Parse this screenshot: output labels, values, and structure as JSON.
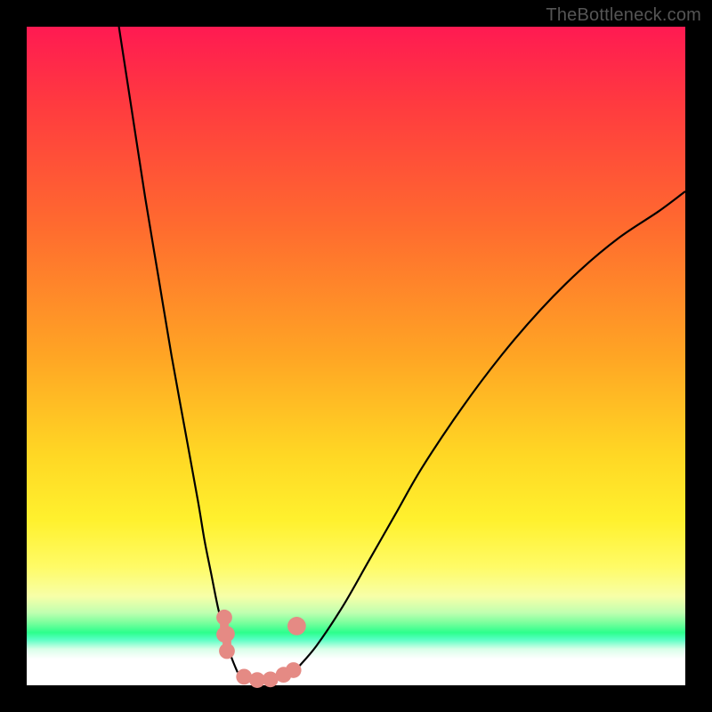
{
  "watermark": "TheBottleneck.com",
  "chart_data": {
    "type": "line",
    "title": "",
    "xlabel": "",
    "ylabel": "",
    "xlim": [
      0,
      100
    ],
    "ylim": [
      0,
      100
    ],
    "grid": false,
    "legend": false,
    "series": [
      {
        "name": "left_branch",
        "x": [
          14,
          16,
          18,
          20,
          22,
          24,
          26,
          27,
          28,
          29,
          30,
          31,
          32
        ],
        "y": [
          100,
          87,
          74,
          62,
          50,
          39,
          28,
          22,
          17,
          12,
          8,
          4.5,
          2
        ]
      },
      {
        "name": "valley_floor",
        "x": [
          32,
          33,
          34,
          35,
          36,
          37,
          38,
          39,
          40,
          41
        ],
        "y": [
          2,
          1.2,
          0.8,
          0.6,
          0.6,
          0.8,
          1.2,
          1.6,
          2,
          2.5
        ]
      },
      {
        "name": "right_branch",
        "x": [
          41,
          44,
          48,
          52,
          56,
          60,
          66,
          72,
          78,
          84,
          90,
          96,
          100
        ],
        "y": [
          2.5,
          6,
          12,
          19,
          26,
          33,
          42,
          50,
          57,
          63,
          68,
          72,
          75
        ]
      }
    ],
    "markers": [
      {
        "shape": "dumbbell",
        "x": 30.0,
        "y": 9.0
      },
      {
        "shape": "dumbbell",
        "x": 30.4,
        "y": 6.5
      },
      {
        "shape": "circle",
        "x": 33.0,
        "y": 1.3,
        "r": 1.2
      },
      {
        "shape": "circle",
        "x": 35.0,
        "y": 0.8,
        "r": 1.2
      },
      {
        "shape": "circle",
        "x": 37.0,
        "y": 0.9,
        "r": 1.2
      },
      {
        "shape": "circle",
        "x": 39.0,
        "y": 1.6,
        "r": 1.2
      },
      {
        "shape": "circle",
        "x": 40.5,
        "y": 2.3,
        "r": 1.2
      },
      {
        "shape": "circle",
        "x": 41.0,
        "y": 9.0,
        "r": 1.4
      }
    ],
    "gradient_stops": [
      {
        "pct": 0,
        "color": "#ff1a52"
      },
      {
        "pct": 30,
        "color": "#ff6a2f"
      },
      {
        "pct": 65,
        "color": "#ffd724"
      },
      {
        "pct": 82,
        "color": "#fffb66"
      },
      {
        "pct": 92,
        "color": "#2cff8c"
      },
      {
        "pct": 100,
        "color": "#ffffff"
      }
    ]
  }
}
